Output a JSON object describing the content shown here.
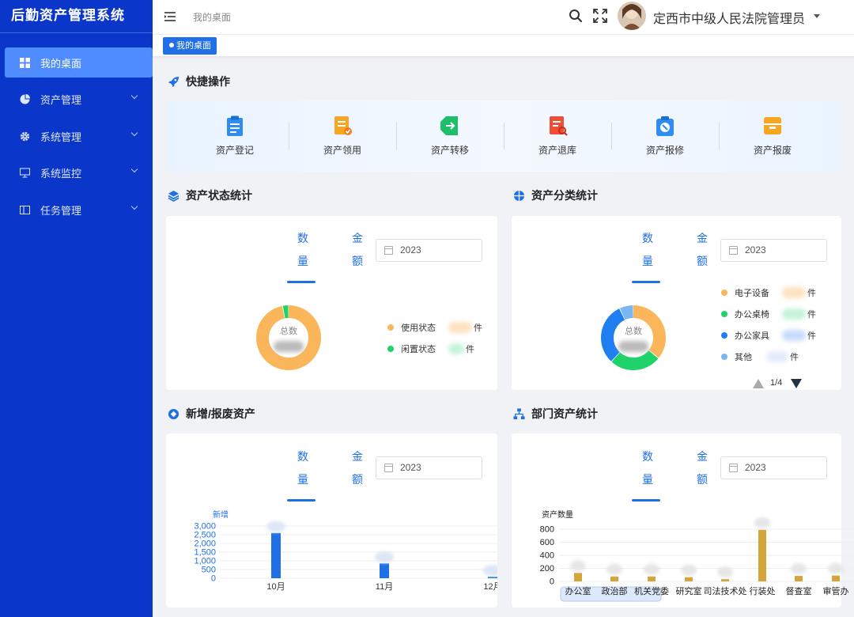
{
  "app": {
    "title": "后勤资产管理系统"
  },
  "sidebar": {
    "items": [
      {
        "label": "我的桌面",
        "icon": "dashboard-icon",
        "active": true
      },
      {
        "label": "资产管理",
        "icon": "pie-icon"
      },
      {
        "label": "系统管理",
        "icon": "gear-icon"
      },
      {
        "label": "系统监控",
        "icon": "monitor-icon"
      },
      {
        "label": "任务管理",
        "icon": "task-icon"
      }
    ]
  },
  "header": {
    "breadcrumb": "我的桌面",
    "user_name": "定西市中级人民法院管理员"
  },
  "tags": {
    "active": "我的桌面"
  },
  "quick": {
    "title": "快捷操作",
    "items": [
      {
        "label": "资产登记",
        "icon": "clipboard-icon",
        "color": "#2f8cf0"
      },
      {
        "label": "资产领用",
        "icon": "document-icon",
        "color": "#f5a623"
      },
      {
        "label": "资产转移",
        "icon": "transfer-icon",
        "color": "#1fbf6a"
      },
      {
        "label": "资产退库",
        "icon": "return-icon",
        "color": "#f04e37"
      },
      {
        "label": "资产报修",
        "icon": "repair-icon",
        "color": "#2f8cf0"
      },
      {
        "label": "资产报废",
        "icon": "scrap-icon",
        "color": "#f5a623"
      }
    ]
  },
  "tab_labels": {
    "count_top": "数",
    "count_bottom": "量",
    "amount_top": "金",
    "amount_bottom": "额"
  },
  "status_stats": {
    "title": "资产状态统计",
    "year": "2023",
    "center_label": "总数",
    "legend": [
      {
        "label": "使用状态",
        "unit": "件",
        "color": "#fbb65b"
      },
      {
        "label": "闲置状态",
        "unit": "件",
        "color": "#1fd36a"
      }
    ]
  },
  "category_stats": {
    "title": "资产分类统计",
    "year": "2023",
    "center_label": "总数",
    "legend": [
      {
        "label": "电子设备",
        "unit": "件",
        "color": "#fbb65b"
      },
      {
        "label": "办公桌椅",
        "unit": "件",
        "color": "#1fd36a"
      },
      {
        "label": "办公家具",
        "unit": "件",
        "color": "#1f7ff0"
      },
      {
        "label": "其他",
        "unit": "件",
        "color": "#7ab6f2"
      }
    ],
    "pager": "1/4"
  },
  "new_scrap": {
    "title": "新增/报废资产",
    "year": "2023",
    "series_label": "新增",
    "y_ticks": [
      "3,000",
      "2,500",
      "2,000",
      "1,500",
      "1,000",
      "500",
      "0"
    ],
    "color": "#1f6fe5"
  },
  "dept_stats": {
    "title": "部门资产统计",
    "year": "2023",
    "axis_label": "资产数量",
    "y_ticks": [
      "800",
      "600",
      "400",
      "200",
      "0"
    ],
    "color": "#d4a53a"
  },
  "chart_data": [
    {
      "type": "pie",
      "name": "资产状态统计",
      "labels": [
        "使用状态",
        "闲置状态"
      ],
      "values": [
        97,
        3
      ]
    },
    {
      "type": "pie",
      "name": "资产分类统计",
      "labels": [
        "电子设备",
        "办公桌椅",
        "办公家具",
        "其他"
      ],
      "values": [
        36,
        26,
        31,
        7
      ]
    },
    {
      "type": "bar",
      "name": "新增/报废资产",
      "categories": [
        "10月",
        "11月",
        "12月"
      ],
      "series": [
        {
          "name": "新增",
          "values": [
            2600,
            850,
            80
          ]
        }
      ],
      "ylim": [
        0,
        3000
      ]
    },
    {
      "type": "bar",
      "name": "部门资产统计",
      "categories": [
        "办公室",
        "政治部",
        "机关党委",
        "研究室",
        "司法技术处",
        "行装处",
        "督查室",
        "审管办"
      ],
      "series": [
        {
          "name": "资产数量",
          "values": [
            130,
            75,
            75,
            65,
            35,
            790,
            85,
            90
          ]
        }
      ],
      "ylim": [
        0,
        800
      ]
    }
  ]
}
